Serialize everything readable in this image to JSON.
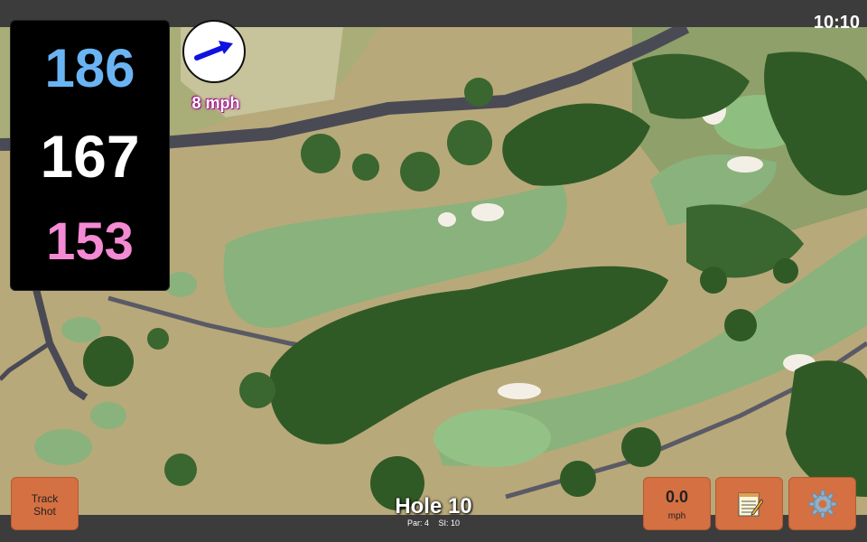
{
  "status_bar": {
    "time": "10:10"
  },
  "distances": {
    "back": "186",
    "middle": "167",
    "front": "153",
    "colors": {
      "back": "#6ab4f4",
      "middle": "#ffffff",
      "front": "#f48ad4"
    }
  },
  "wind": {
    "label": "8 mph",
    "arrow_color": "#1010e0",
    "arrow_direction": "toward upper-right"
  },
  "hole": {
    "title": "Hole 10",
    "par": "Par: 4",
    "si": "SI: 10"
  },
  "buttons": {
    "track_shot_line1": "Track",
    "track_shot_line2": "Shot",
    "wind_value": "0.0",
    "wind_unit": "mph",
    "notes_icon": "notepad-icon",
    "settings_icon": "gear-icon"
  },
  "colors": {
    "button_bg": "#d47042",
    "bar_bg": "#3c3c3c",
    "wind_text_outline": "#a01a8a"
  }
}
